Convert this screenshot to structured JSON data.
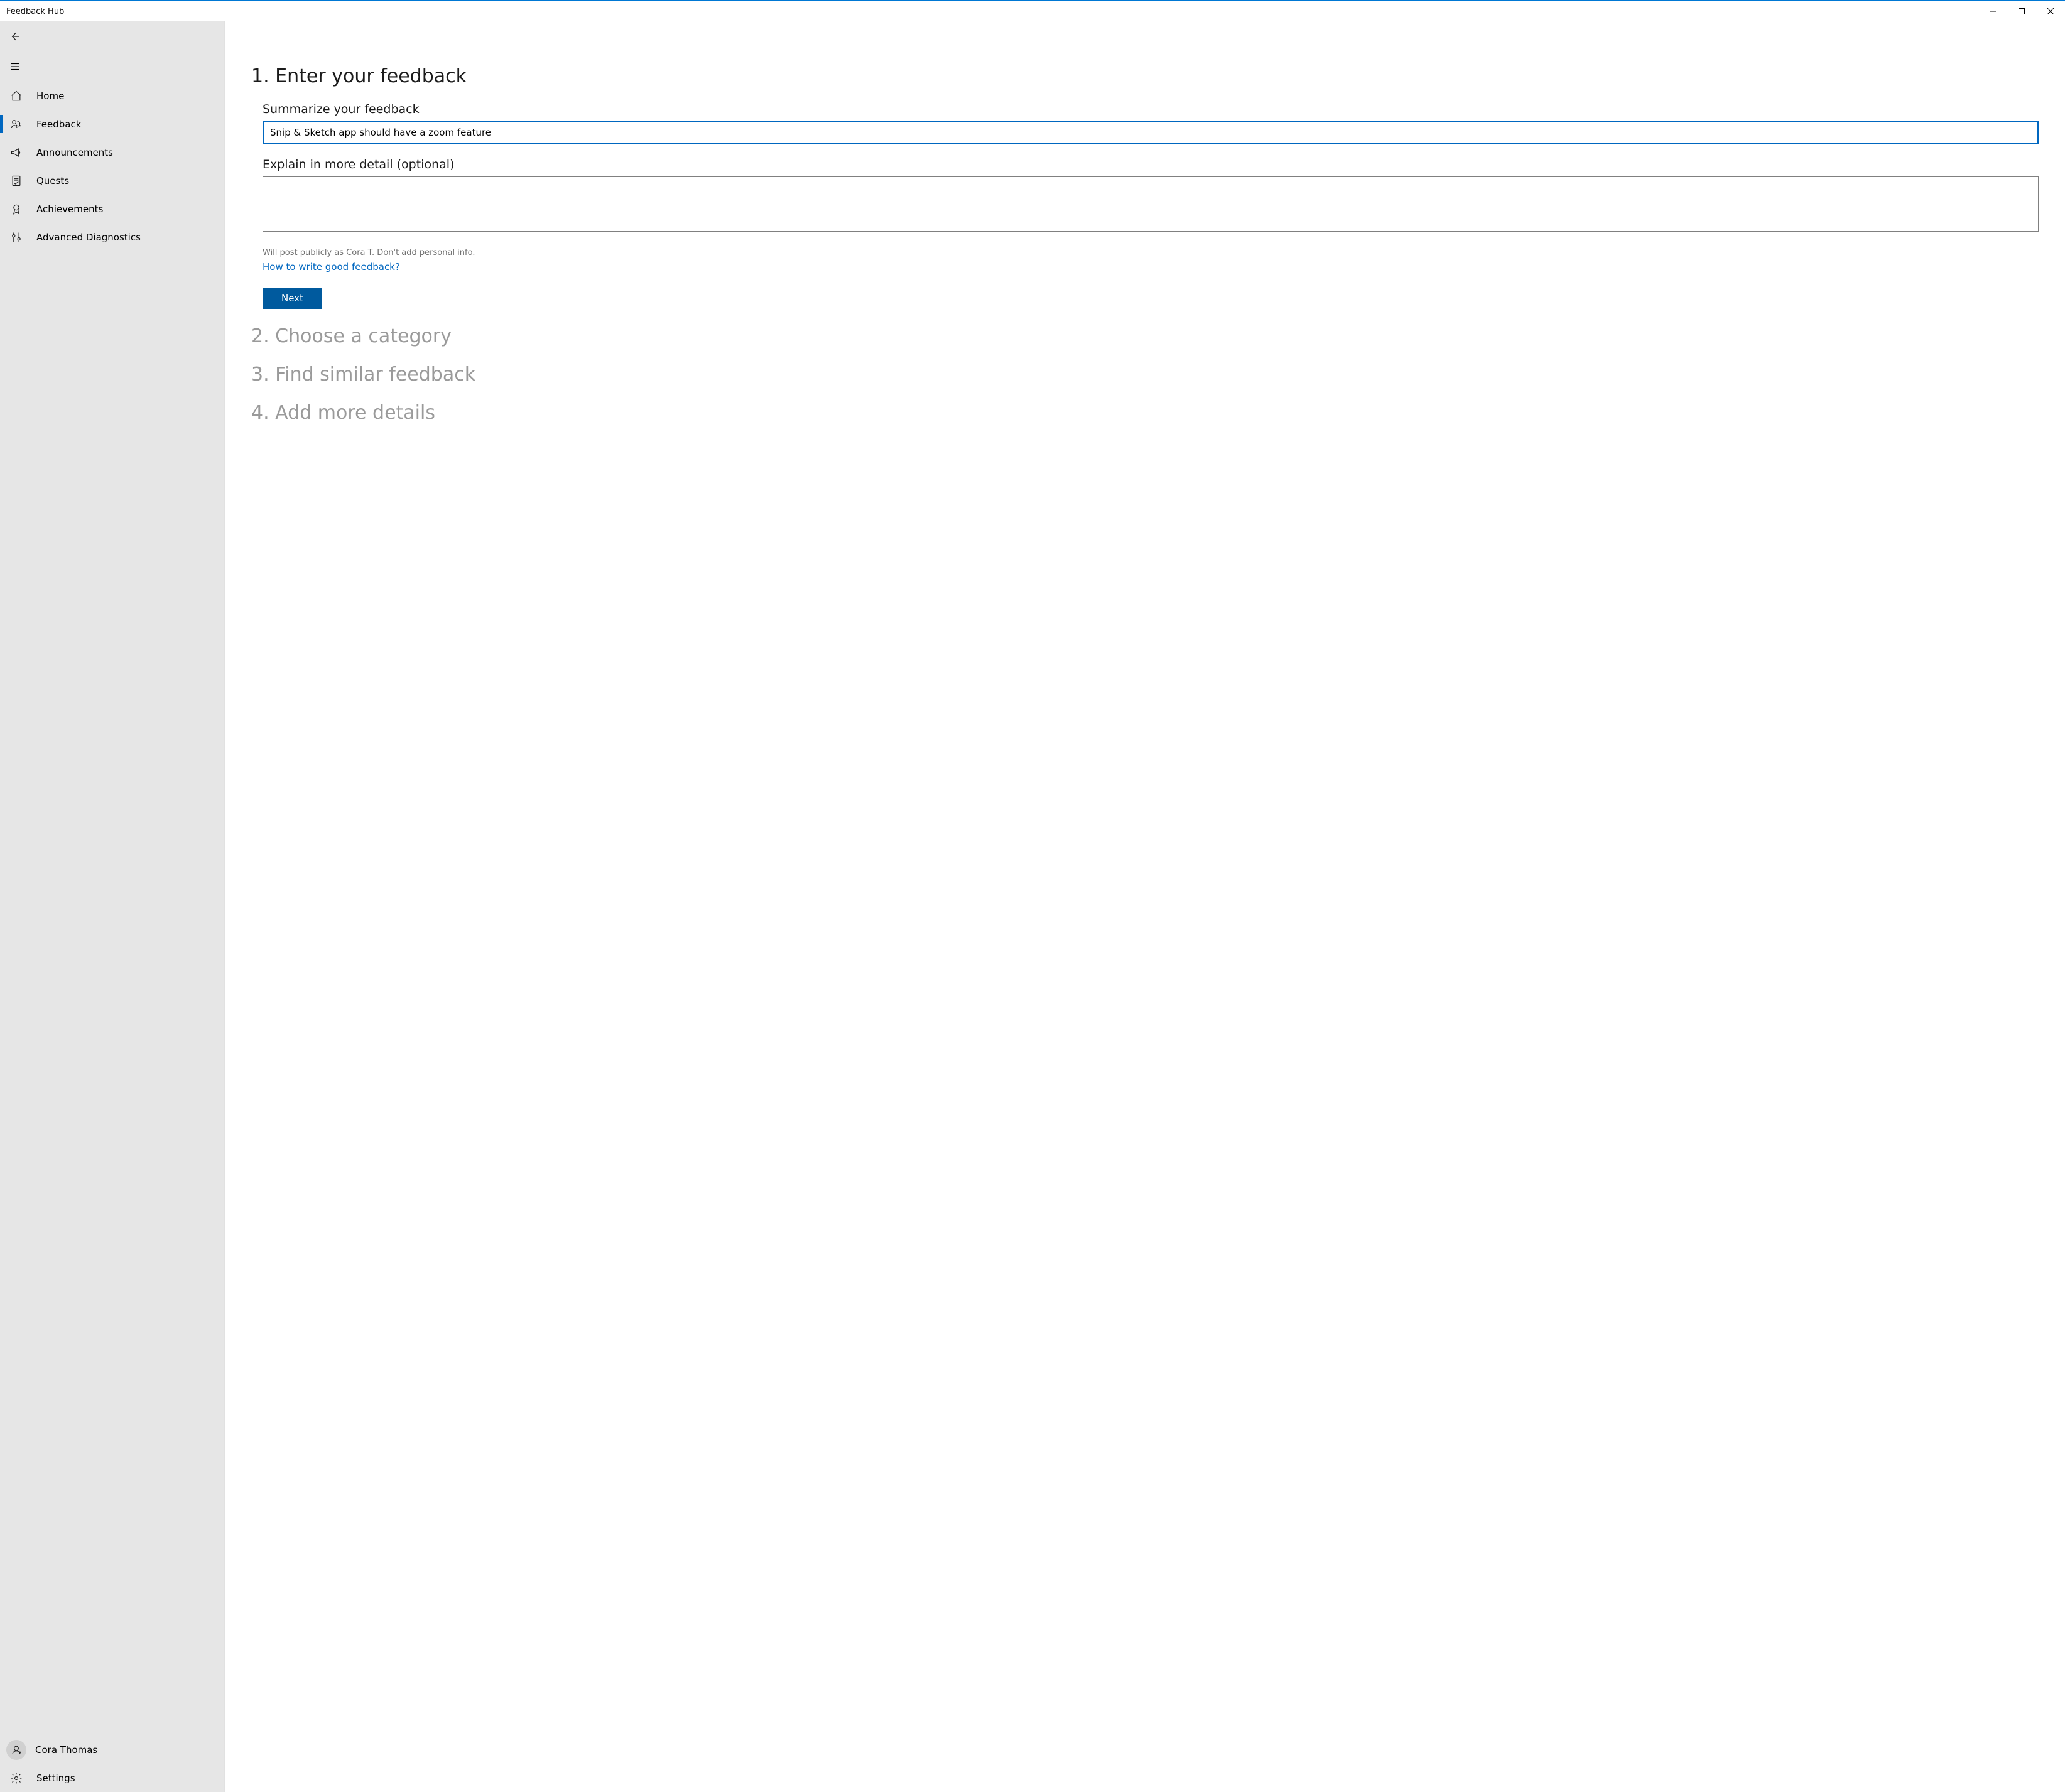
{
  "window": {
    "title": "Feedback Hub"
  },
  "sidebar": {
    "items": [
      {
        "label": "Home",
        "icon": "home-icon"
      },
      {
        "label": "Feedback",
        "icon": "feedback-icon",
        "selected": true
      },
      {
        "label": "Announcements",
        "icon": "megaphone-icon"
      },
      {
        "label": "Quests",
        "icon": "quests-icon"
      },
      {
        "label": "Achievements",
        "icon": "medal-icon"
      },
      {
        "label": "Advanced Diagnostics",
        "icon": "diagnostics-icon"
      }
    ],
    "account": {
      "name": "Cora Thomas"
    },
    "settings_label": "Settings"
  },
  "steps": {
    "s1": "1. Enter your feedback",
    "s2": "2. Choose a category",
    "s3": "3. Find similar feedback",
    "s4": "4. Add more details"
  },
  "form": {
    "summary_label": "Summarize your feedback",
    "summary_value": "Snip & Sketch app should have a zoom feature",
    "detail_label": "Explain in more detail (optional)",
    "detail_value": "",
    "privacy_note": "Will post publicly as Cora T. Don't add personal info.",
    "help_link": "How to write good feedback?",
    "next_label": "Next"
  }
}
